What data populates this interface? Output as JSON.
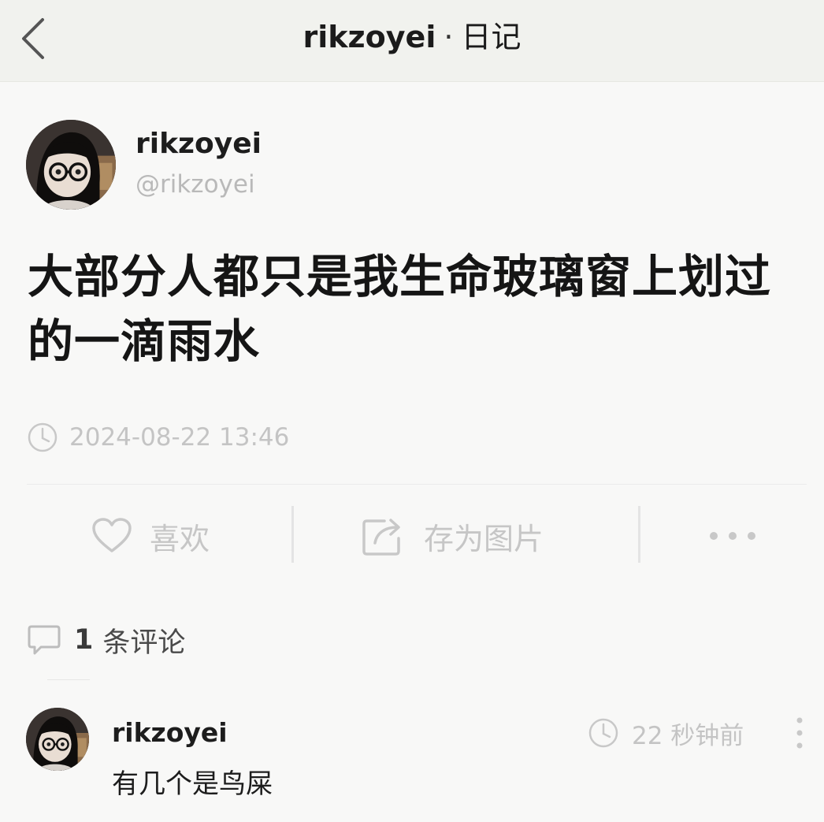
{
  "header": {
    "username": "rikzoyei",
    "separator": "·",
    "section": "日记"
  },
  "post": {
    "author_name": "rikzoyei",
    "author_handle": "@rikzoyei",
    "text": "大部分人都只是我生命玻璃窗上划过的一滴雨水",
    "timestamp": "2024-08-22 13:46"
  },
  "actions": {
    "like_label": "喜欢",
    "save_image_label": "存为图片",
    "more_icon": "ellipsis-icon"
  },
  "comments": {
    "count": "1",
    "label": "条评论",
    "items": [
      {
        "author": "rikzoyei",
        "text": "有几个是鸟屎",
        "time": "22 秒钟前"
      }
    ]
  },
  "icons": {
    "back": "chevron-left-icon",
    "clock": "clock-icon",
    "like": "heart-icon",
    "save": "share-box-icon",
    "comment": "speech-bubble-icon",
    "comment_more": "vertical-ellipsis-icon"
  },
  "colors": {
    "topbar_bg": "#f1f2ee",
    "page_bg": "#f8f8f7",
    "muted_text": "#c4c4c4"
  }
}
